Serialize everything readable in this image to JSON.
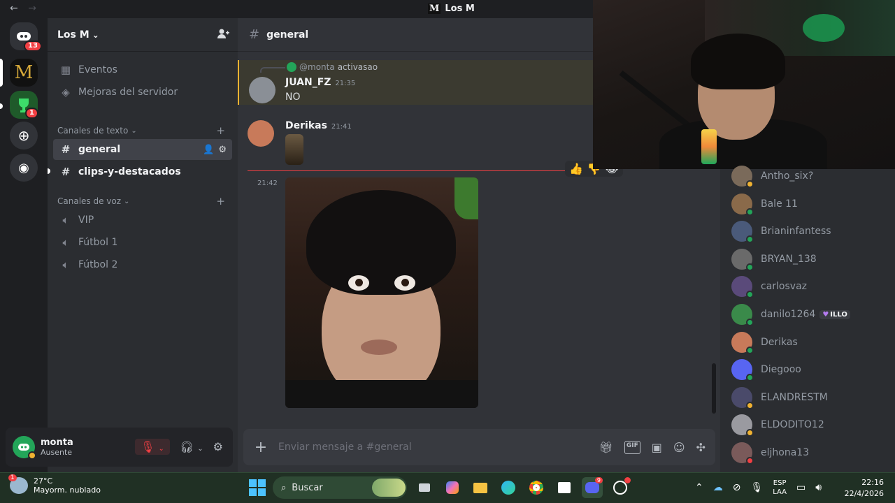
{
  "titlebar": {
    "back": "←",
    "forward": "→",
    "logo": "M",
    "server_name": "Los M"
  },
  "rail": {
    "home_badge": "13",
    "server_badge": "1",
    "server_logo": "M"
  },
  "sidebar": {
    "server_name": "Los M",
    "chevron": "⌄",
    "events": "Eventos",
    "boosts": "Mejoras del servidor",
    "text_category": "Canales de texto",
    "voice_category": "Canales de voz",
    "text_channels": [
      "general",
      "clips-y-destacados"
    ],
    "voice_channels": [
      "VIP",
      "Fútbol 1",
      "Fútbol 2"
    ]
  },
  "user": {
    "name": "monta",
    "status": "Ausente"
  },
  "chat": {
    "channel": "general",
    "reply_to": "@monta",
    "reply_text": "activasao",
    "messages": [
      {
        "author": "JUAN_FZ",
        "time": "21:35",
        "text": "NO"
      },
      {
        "author": "Derikas",
        "time": "21:41",
        "text": ""
      }
    ],
    "image_time": "21:42",
    "composer_placeholder": "Enviar mensaje a #general",
    "gif_label": "GIF"
  },
  "members": [
    {
      "name": "Antho_six?",
      "color": "#7a6a5a",
      "status": "#f0b232"
    },
    {
      "name": "Bale 11",
      "color": "#8a6a4a",
      "status": "#23a559"
    },
    {
      "name": "Brianinfantess",
      "color": "#4a5a7a",
      "status": "#23a559"
    },
    {
      "name": "BRYAN_138",
      "color": "#6a6a6a",
      "status": "#23a559"
    },
    {
      "name": "carlosvaz",
      "color": "#5a4a7a",
      "status": "#23a559"
    },
    {
      "name": "danilo1264",
      "color": "#3a8a4a",
      "status": "#23a559",
      "tag": "ILLO"
    },
    {
      "name": "Derikas",
      "color": "#c87a5a",
      "status": "#23a559"
    },
    {
      "name": "Diegooo",
      "color": "#5865f2",
      "status": "#23a559"
    },
    {
      "name": "ELANDRESTM",
      "color": "#4a4a6a",
      "status": "#f0b232"
    },
    {
      "name": "ELDODITO12",
      "color": "#9a9aa0",
      "status": "#f0b232"
    },
    {
      "name": "eljhona13",
      "color": "#7a5a5a",
      "status": "#f23f43"
    }
  ],
  "taskbar": {
    "weather_temp": "27°C",
    "weather_desc": "Mayorm. nublado",
    "weather_badge": "1",
    "search_label": "Buscar",
    "discord_badge": "9",
    "lang_1": "ESP",
    "lang_2": "LAA",
    "time": "22:16",
    "date": "22/4/2026"
  }
}
